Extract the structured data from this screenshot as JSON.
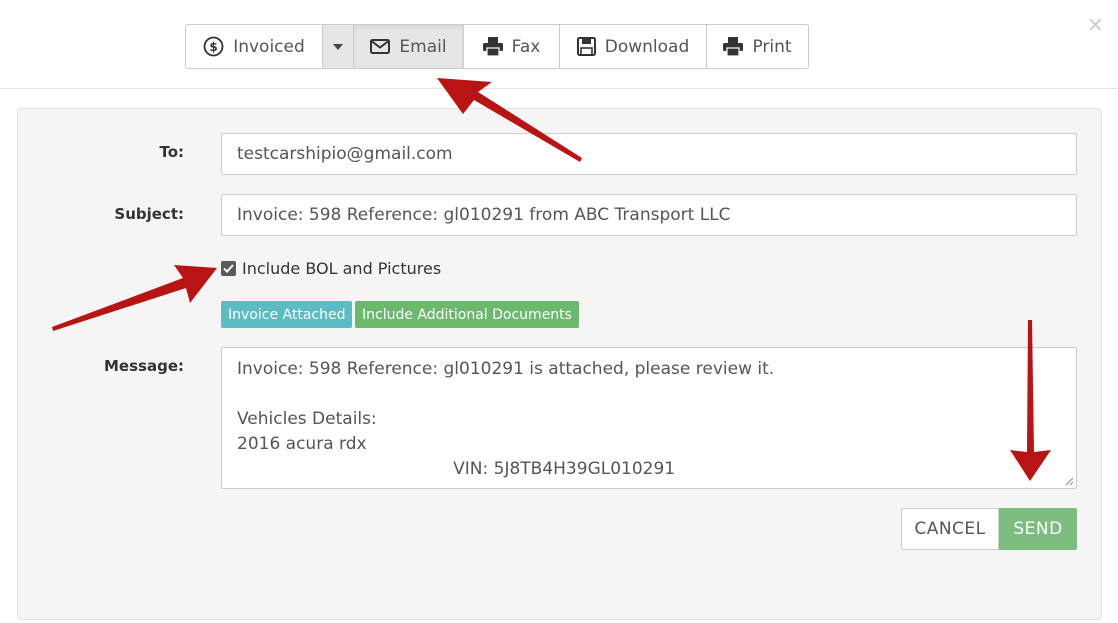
{
  "toolbar": {
    "invoiced_label": "Invoiced",
    "email_label": "Email",
    "fax_label": "Fax",
    "download_label": "Download",
    "print_label": "Print",
    "icons": [
      "dollar-circle-icon",
      "caret-down-icon",
      "envelope-icon",
      "fax-icon",
      "floppy-disk-icon",
      "printer-icon"
    ]
  },
  "dialog": {
    "close_glyph": "×"
  },
  "form": {
    "to_label": "To:",
    "to_value": "testcarshipio@gmail.com",
    "subject_label": "Subject:",
    "subject_value": "Invoice: 598 Reference: gl010291 from ABC Transport LLC",
    "include_bol_label": "Include BOL and Pictures",
    "include_bol_checked": true,
    "badge_invoice_attached": "Invoice Attached",
    "badge_additional_docs": "Include Additional Documents",
    "message_label": "Message:",
    "message_lines": [
      "Invoice: 598 Reference: gl010291 is attached, please review it.",
      "",
      "Vehicles Details:",
      "2016 acura rdx",
      "                                        VIN: 5J8TB4H39GL010291"
    ],
    "cancel_label": "CANCEL",
    "send_label": "SEND"
  },
  "colors": {
    "badge_info": "#5bbcc4",
    "badge_success": "#6ab96d",
    "send_button": "#7dbd80",
    "annotation_arrow": "#b81414",
    "panel_bg": "#f5f5f5"
  }
}
